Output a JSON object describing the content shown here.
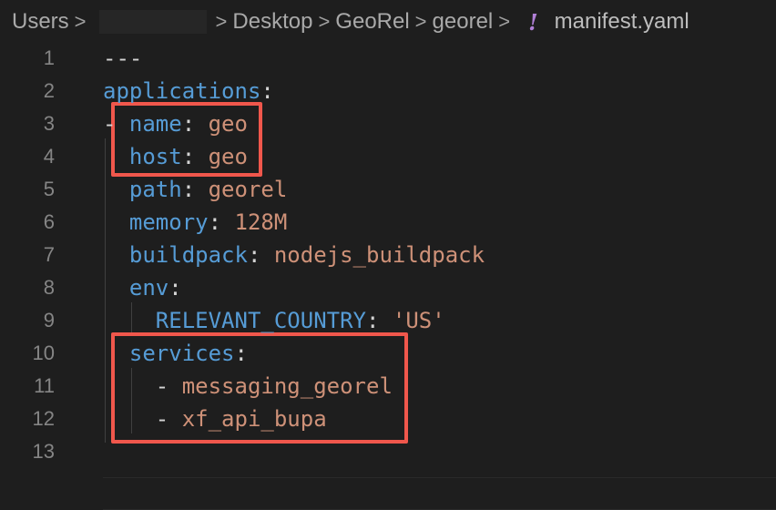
{
  "breadcrumb": {
    "items": [
      {
        "label": "Users"
      },
      {
        "label": ""
      },
      {
        "label": "Desktop"
      },
      {
        "label": "GeoRel"
      },
      {
        "label": "georel"
      }
    ],
    "separator": ">",
    "file_icon": "!",
    "file_name": "manifest.yaml"
  },
  "editor": {
    "lines": [
      {
        "num": "1",
        "tokens": [
          {
            "t": "---",
            "c": "punct"
          }
        ]
      },
      {
        "num": "2",
        "tokens": [
          {
            "t": "applications",
            "c": "key"
          },
          {
            "t": ":",
            "c": "punct"
          }
        ]
      },
      {
        "num": "3",
        "tokens": [
          {
            "t": "- ",
            "c": "punct"
          },
          {
            "t": "name",
            "c": "key"
          },
          {
            "t": ": ",
            "c": "punct"
          },
          {
            "t": "geo",
            "c": "val"
          }
        ]
      },
      {
        "num": "4",
        "tokens": [
          {
            "t": "  ",
            "c": "punct"
          },
          {
            "t": "host",
            "c": "key"
          },
          {
            "t": ": ",
            "c": "punct"
          },
          {
            "t": "geo",
            "c": "val"
          }
        ]
      },
      {
        "num": "5",
        "tokens": [
          {
            "t": "  ",
            "c": "punct"
          },
          {
            "t": "path",
            "c": "key"
          },
          {
            "t": ": ",
            "c": "punct"
          },
          {
            "t": "georel",
            "c": "val"
          }
        ]
      },
      {
        "num": "6",
        "tokens": [
          {
            "t": "  ",
            "c": "punct"
          },
          {
            "t": "memory",
            "c": "key"
          },
          {
            "t": ": ",
            "c": "punct"
          },
          {
            "t": "128M",
            "c": "val"
          }
        ]
      },
      {
        "num": "7",
        "tokens": [
          {
            "t": "  ",
            "c": "punct"
          },
          {
            "t": "buildpack",
            "c": "key"
          },
          {
            "t": ": ",
            "c": "punct"
          },
          {
            "t": "nodejs_buildpack",
            "c": "val"
          }
        ]
      },
      {
        "num": "8",
        "tokens": [
          {
            "t": "  ",
            "c": "punct"
          },
          {
            "t": "env",
            "c": "key"
          },
          {
            "t": ":",
            "c": "punct"
          }
        ]
      },
      {
        "num": "9",
        "tokens": [
          {
            "t": "    ",
            "c": "punct"
          },
          {
            "t": "RELEVANT_COUNTRY",
            "c": "key"
          },
          {
            "t": ": ",
            "c": "punct"
          },
          {
            "t": "'US'",
            "c": "val"
          }
        ]
      },
      {
        "num": "10",
        "tokens": [
          {
            "t": "  ",
            "c": "punct"
          },
          {
            "t": "services",
            "c": "key"
          },
          {
            "t": ":",
            "c": "punct"
          }
        ]
      },
      {
        "num": "11",
        "tokens": [
          {
            "t": "    - ",
            "c": "punct"
          },
          {
            "t": "messaging_georel",
            "c": "val"
          }
        ]
      },
      {
        "num": "12",
        "tokens": [
          {
            "t": "    - ",
            "c": "punct"
          },
          {
            "t": "xf_api_bupa",
            "c": "val"
          }
        ]
      },
      {
        "num": "13",
        "tokens": []
      }
    ]
  },
  "colors": {
    "background": "#1e1e1e",
    "key": "#569cd6",
    "string": "#ce9178",
    "highlight_box": "#f0574c",
    "yaml_icon": "#b180d7"
  }
}
